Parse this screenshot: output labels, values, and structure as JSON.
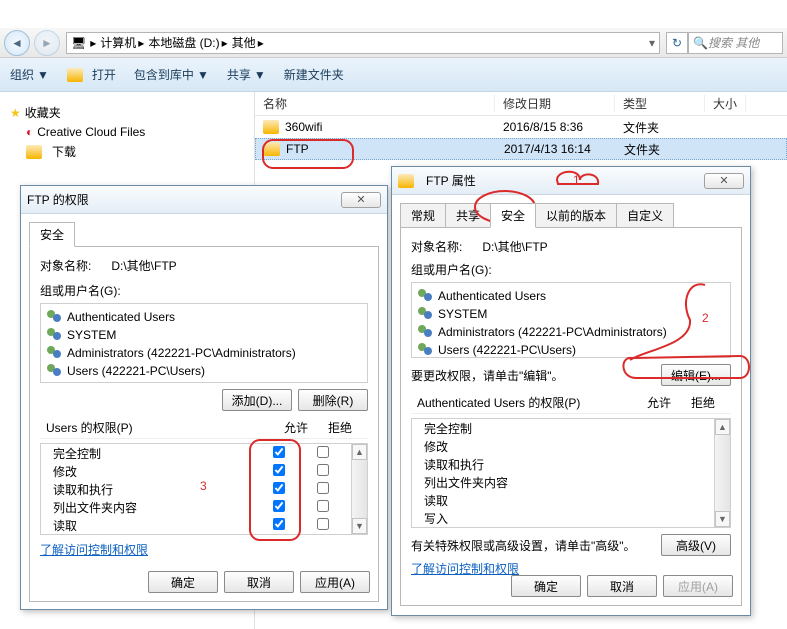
{
  "nav": {
    "crumbs": [
      "计算机",
      "本地磁盘 (D:)",
      "其他"
    ],
    "search_placeholder": "搜索 其他"
  },
  "toolbar": {
    "organize": "组织",
    "open": "打开",
    "include": "包含到库中",
    "share": "共享",
    "newfolder": "新建文件夹",
    "dropdown": "▼"
  },
  "sidebar": {
    "favorites": "收藏夹",
    "items": [
      "Creative Cloud Files",
      "下载"
    ]
  },
  "columns": {
    "name": "名称",
    "date": "修改日期",
    "type": "类型",
    "size": "大小"
  },
  "files": [
    {
      "name": "360wifi",
      "date": "2016/8/15 8:36",
      "type": "文件夹"
    },
    {
      "name": "FTP",
      "date": "2017/4/13 16:14",
      "type": "文件夹"
    }
  ],
  "dlg_perm": {
    "title": "FTP 的权限",
    "tab_security": "安全",
    "object_label": "对象名称:",
    "object_value": "D:\\其他\\FTP",
    "group_label": "组或用户名(G):",
    "principals": [
      "Authenticated Users",
      "SYSTEM",
      "Administrators (422221-PC\\Administrators)",
      "Users (422221-PC\\Users)"
    ],
    "add": "添加(D)...",
    "remove": "删除(R)",
    "perm_header": "Users 的权限(P)",
    "allow": "允许",
    "deny": "拒绝",
    "perms": [
      "完全控制",
      "修改",
      "读取和执行",
      "列出文件夹内容",
      "读取"
    ],
    "link": "了解访问控制和权限",
    "ok": "确定",
    "cancel": "取消",
    "apply": "应用(A)"
  },
  "dlg_props": {
    "title": "FTP 属性",
    "tabs": [
      "常规",
      "共享",
      "安全",
      "以前的版本",
      "自定义"
    ],
    "object_label": "对象名称:",
    "object_value": "D:\\其他\\FTP",
    "group_label": "组或用户名(G):",
    "principals": [
      "Authenticated Users",
      "SYSTEM",
      "Administrators (422221-PC\\Administrators)",
      "Users (422221-PC\\Users)"
    ],
    "edit_hint": "要更改权限，请单击\"编辑\"。",
    "edit": "编辑(E)...",
    "perm_header": "Authenticated Users 的权限(P)",
    "allow": "允许",
    "deny": "拒绝",
    "perms": [
      "完全控制",
      "修改",
      "读取和执行",
      "列出文件夹内容",
      "读取",
      "写入"
    ],
    "adv_hint": "有关特殊权限或高级设置，请单击\"高级\"。",
    "adv": "高级(V)",
    "link": "了解访问控制和权限",
    "ok": "确定",
    "cancel": "取消",
    "apply": "应用(A)"
  },
  "annotations": {
    "n1": "1",
    "n2": "2",
    "n3": "3"
  }
}
